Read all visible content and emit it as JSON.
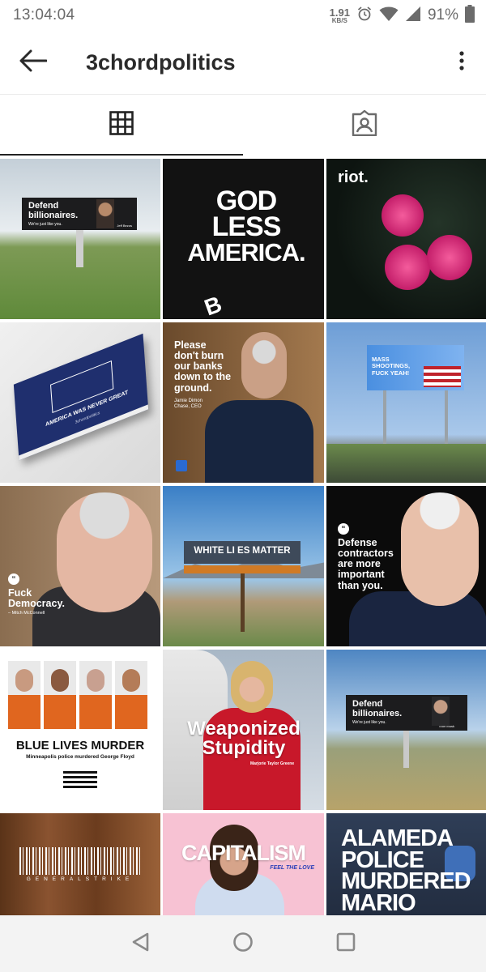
{
  "status_bar": {
    "time": "13:04:04",
    "net_speed": "1.91",
    "net_unit": "KB/S",
    "battery": "91%",
    "icons": [
      "alarm-icon",
      "wifi-icon",
      "signal-icon",
      "battery-icon"
    ]
  },
  "app_bar": {
    "title": "3chordpolitics",
    "back_icon": "arrow-left-icon",
    "more_icon": "more-vertical-icon"
  },
  "tabs": [
    {
      "icon": "grid-icon",
      "active": true
    },
    {
      "icon": "tagged-person-icon",
      "active": false
    }
  ],
  "posts": [
    {
      "headline": "Defend billionaires.",
      "sub": "We're just like you.",
      "caption": "Jeff Bezos"
    },
    {
      "headline_lines": [
        "GOD",
        "LESS",
        "AMERICA."
      ],
      "mark": "B"
    },
    {
      "headline": "riot."
    },
    {
      "headline": "AMERICA WAS NEVER GREAT",
      "sub": "3chordpolitics"
    },
    {
      "headline_lines": [
        "Please",
        "don't burn",
        "our banks",
        "down to the",
        "ground."
      ],
      "caption_lines": [
        "Jamie Dimon",
        "Chase, CEO"
      ]
    },
    {
      "headline_lines": [
        "MASS",
        "SHOOTINGS,",
        "FUCK YEAH!"
      ]
    },
    {
      "headline_lines": [
        "Fuck",
        "Democracy."
      ],
      "caption": "– Mitch McConnell"
    },
    {
      "headline": "WHITE LI  ES MATTER"
    },
    {
      "headline_lines": [
        "Defense",
        "contractors",
        "are more",
        "important",
        "than you."
      ]
    },
    {
      "headline": "BLUE LIVES MURDER",
      "sub": "Minneapolis police murdered George Floyd"
    },
    {
      "headline_lines": [
        "Weaponized",
        "Stupidity"
      ],
      "caption": "Marjorie Taylor Greene"
    },
    {
      "headline": "Defend billionaires.",
      "sub": "We're just like you.",
      "caption": "Elon Musk"
    },
    {
      "headline": "GENERALSTRIKE"
    },
    {
      "headline": "CAPITALISM",
      "sub": "FEEL THE LOVE"
    },
    {
      "headline_lines": [
        "ALAMEDA",
        "POLICE",
        "MURDERED",
        "MARIO"
      ]
    }
  ],
  "nav_bar": {
    "icons": [
      "back-triangle-icon",
      "home-circle-icon",
      "recents-square-icon"
    ]
  },
  "colors": {
    "accent_dark": "#222222",
    "status_text": "#6b6b6b",
    "nav_bg": "#f3f3f3"
  }
}
